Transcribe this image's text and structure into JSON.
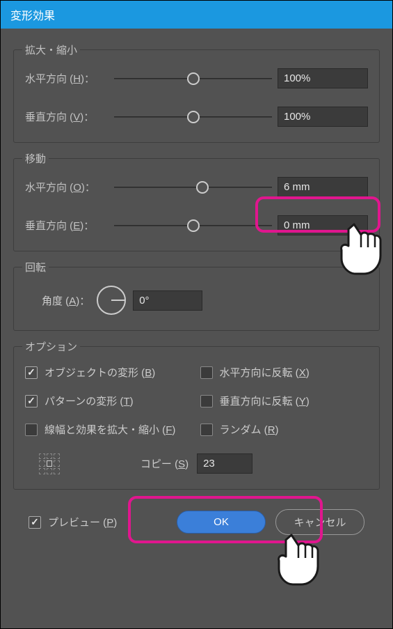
{
  "title": "変形効果",
  "scale": {
    "legend": "拡大・縮小",
    "h_label": "水平方向",
    "h_key": "H",
    "h_value": "100%",
    "v_label": "垂直方向",
    "v_key": "V",
    "v_value": "100%"
  },
  "move": {
    "legend": "移動",
    "h_label": "水平方向",
    "h_key": "O",
    "h_value": "6 mm",
    "h_thumb_pos": "56%",
    "v_label": "垂直方向",
    "v_key": "E",
    "v_value": "0 mm",
    "v_thumb_pos": "50%"
  },
  "rotate": {
    "legend": "回転",
    "angle_label": "角度",
    "angle_key": "A",
    "angle_value": "0°"
  },
  "options": {
    "legend": "オプション",
    "transform_obj": {
      "label": "オブジェクトの変形",
      "key": "B",
      "checked": true
    },
    "flip_h": {
      "label": "水平方向に反転",
      "key": "X",
      "checked": false
    },
    "transform_pat": {
      "label": "パターンの変形",
      "key": "T",
      "checked": true
    },
    "flip_v": {
      "label": "垂直方向に反転",
      "key": "Y",
      "checked": false
    },
    "scale_strokes": {
      "label": "線幅と効果を拡大・縮小",
      "key": "F",
      "checked": false
    },
    "random": {
      "label": "ランダム",
      "key": "R",
      "checked": false
    },
    "copy_label": "コピー",
    "copy_key": "S",
    "copy_value": "23"
  },
  "footer": {
    "preview_label": "プレビュー",
    "preview_key": "P",
    "preview_checked": true,
    "ok": "OK",
    "cancel": "キャンセル"
  }
}
